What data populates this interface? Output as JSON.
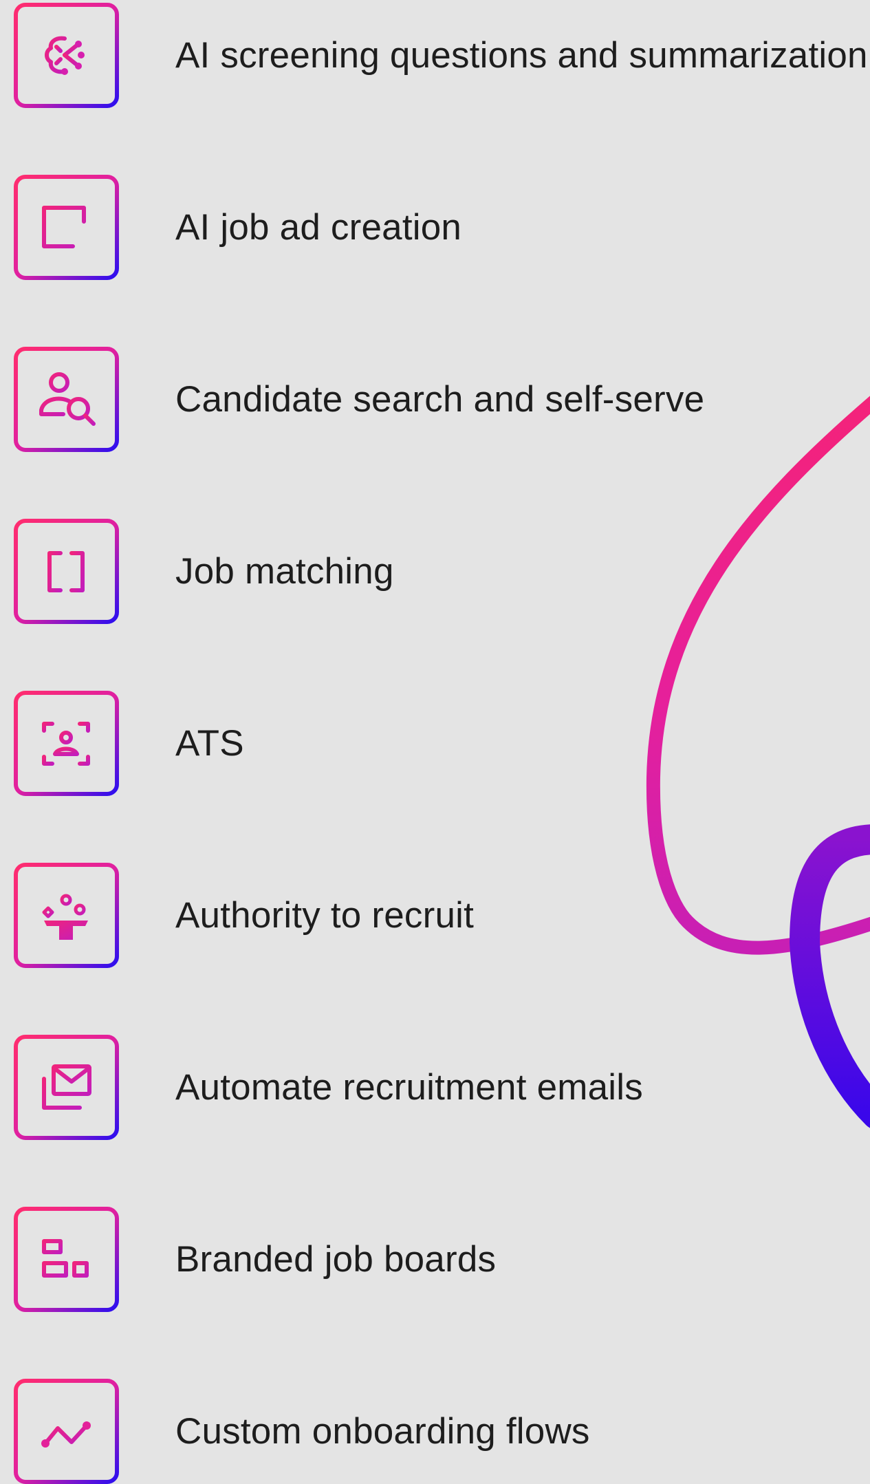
{
  "features": [
    {
      "label": "AI screening questions and summarization",
      "icon": "ai-brain-icon"
    },
    {
      "label": "AI job ad creation",
      "icon": "window-add-icon"
    },
    {
      "label": "Candidate search and self-serve",
      "icon": "person-search-icon"
    },
    {
      "label": "Job matching",
      "icon": "document-compare-icon"
    },
    {
      "label": "ATS",
      "icon": "person-scan-icon"
    },
    {
      "label": "Authority to recruit",
      "icon": "award-podium-icon"
    },
    {
      "label": "Automate recruitment emails",
      "icon": "mail-stack-icon"
    },
    {
      "label": "Branded job boards",
      "icon": "dashboard-grid-icon"
    },
    {
      "label": "Custom onboarding flows",
      "icon": "line-graph-icon"
    }
  ],
  "colors": {
    "background": "#e4e4e4",
    "text": "#1d1d1d",
    "gradient_start": "#ff2d6e",
    "gradient_mid": "#e020a0",
    "gradient_end": "#2a0ef0"
  }
}
